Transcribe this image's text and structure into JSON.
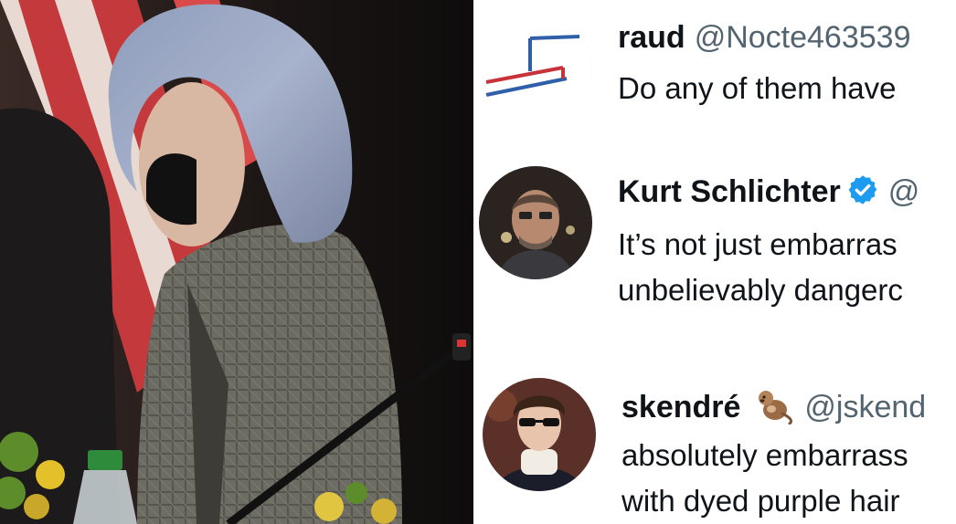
{
  "photo": {
    "alt": ""
  },
  "tweets": [
    {
      "name": "raud",
      "handle": "@Nocte463539",
      "lines": [
        "Do any of them have"
      ],
      "avatar_icon": "brand-stripes-logo"
    },
    {
      "name": "Kurt Schlichter",
      "handle": "@",
      "verified": true,
      "lines": [
        "It’s not just embarras",
        "unbelievably dangerc"
      ],
      "avatar_icon": "man-portrait"
    },
    {
      "name": "skendré",
      "handle": "@jskend",
      "emoji_icon": "otter-emoji",
      "lines": [
        "absolutely embarrass",
        "with dyed purple hair"
      ],
      "avatar_icon": "man-sunglasses-neckbrace"
    }
  ],
  "colors": {
    "name": "#0f1419",
    "handle": "#536471",
    "verified": "#1d9bf0",
    "logo_red": "#c8323a",
    "logo_blue": "#2f5fa8"
  }
}
